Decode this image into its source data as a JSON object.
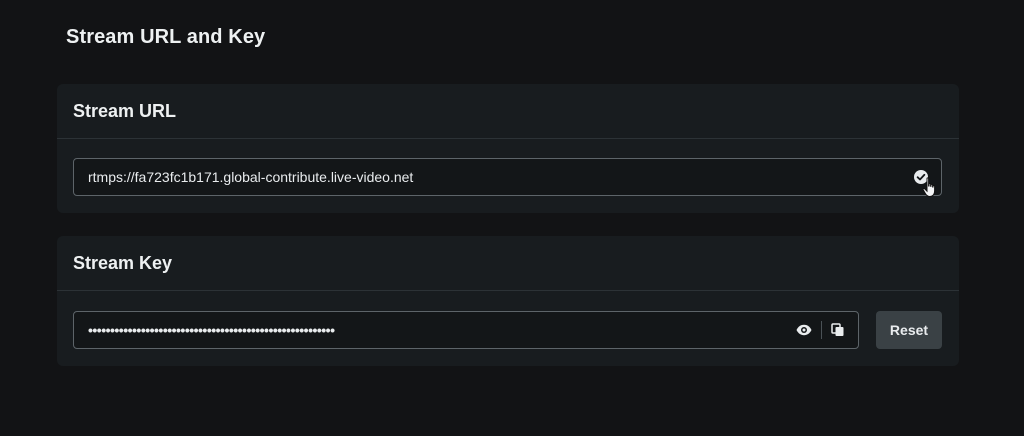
{
  "page": {
    "title": "Stream URL and Key"
  },
  "stream_url": {
    "header": "Stream URL",
    "value": "rtmps://fa723fc1b171.global-contribute.live-video.net",
    "action_icon": "check-circle-icon"
  },
  "stream_key": {
    "header": "Stream Key",
    "masked_value": "••••••••••••••••••••••••••••••••••••••••••••••••••••••••",
    "show_icon": "eye-icon",
    "copy_icon": "copy-icon",
    "reset_label": "Reset"
  },
  "colors": {
    "background": "#121315",
    "card": "#181c1f",
    "field_border": "#5d6469",
    "button": "#3a4145",
    "text": "#eef1f2"
  }
}
